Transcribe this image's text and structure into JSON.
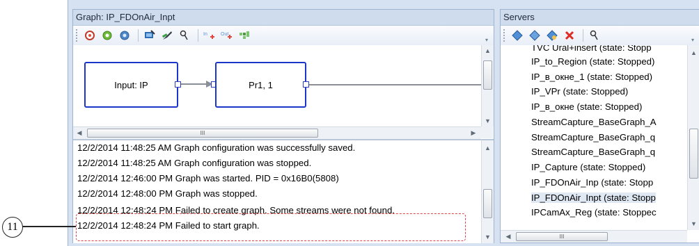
{
  "graph_panel": {
    "title": "Graph: IP_FDOnAir_Inpt",
    "toolbar_icons": [
      "add-icon",
      "refresh-icon",
      "settings-icon",
      "monitor-icon",
      "brush-icon",
      "pin-icon",
      "in-icon",
      "out-icon",
      "grid-icon"
    ],
    "toolbar_labels": {
      "in": "In",
      "out": "Out"
    },
    "nodes": {
      "input": "Input: IP",
      "processor": "Pr1, 1"
    },
    "hscroll_grip": "III"
  },
  "log": {
    "lines": [
      "12/2/2014 11:48:25 AM Graph configuration was successfully saved.",
      "12/2/2014 11:48:25 AM Graph configuration was stopped.",
      "12/2/2014 12:46:00 PM Graph was started. PID = 0x16B0(5808)",
      "12/2/2014 12:48:00 PM Graph was stopped.",
      "12/2/2014 12:48:24 PM Failed to create graph. Some streams were not found.",
      "12/2/2014 12:48:24 PM Failed to start graph."
    ]
  },
  "servers_panel": {
    "title": "Servers",
    "items": [
      "TVC Ural+insert (state: Stopp",
      "IP_to_Region (state: Stopped)",
      "IP_в_окне_1 (state: Stopped)",
      "IP_VPr (state: Stopped)",
      "IP_в_окне (state: Stopped)",
      "StreamCapture_BaseGraph_A",
      "StreamCapture_BaseGraph_q",
      "StreamCapture_BaseGraph_q",
      "IP_Capture (state: Stopped)",
      "IP_FDOnAir_Inp (state: Stopp",
      "IP_FDOnAir_Inpt (state: Stopp",
      "IPCamAx_Reg (state: Stoppec"
    ],
    "selected_index": 10,
    "hscroll_grip": "III"
  },
  "callout": {
    "number": "11"
  },
  "colors": {
    "node_border": "#1a35c8",
    "highlight": "#d9444a",
    "panel_header": "#cfdcee"
  }
}
